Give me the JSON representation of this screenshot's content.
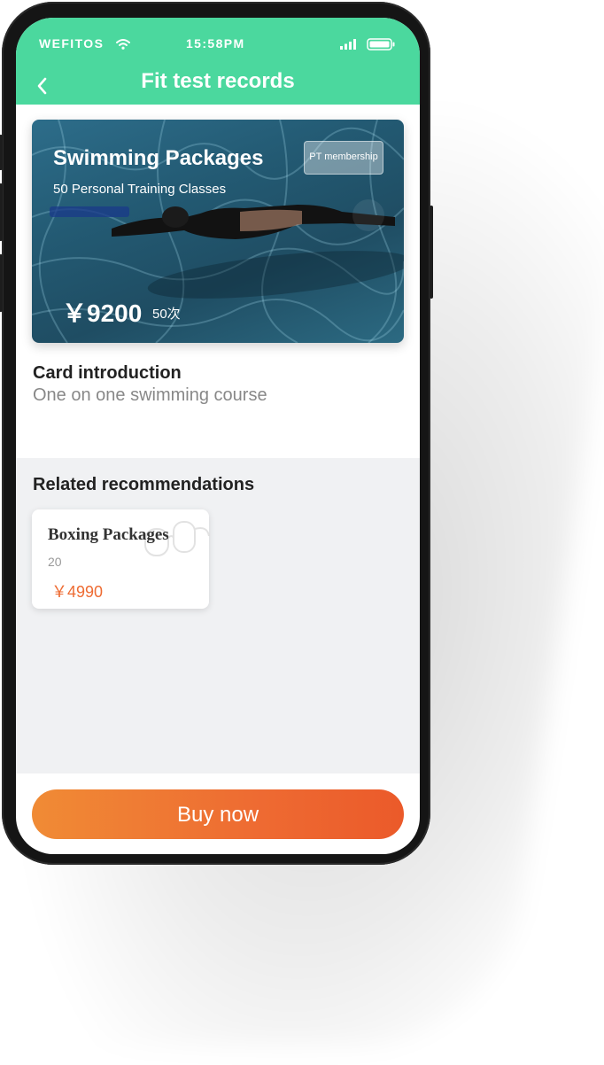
{
  "status_bar": {
    "carrier": "WEFITOS",
    "time": "15:58PM"
  },
  "header": {
    "title": "Fit test records"
  },
  "package_card": {
    "title": "Swimming Packages",
    "subtitle": "50 Personal Training Classes",
    "badge": "PT membership",
    "price": "￥9200",
    "count": "50次"
  },
  "introduction": {
    "title": "Card introduction",
    "text": "One on one swimming course"
  },
  "related": {
    "title": "Related recommendations",
    "items": [
      {
        "title": "Boxing Packages",
        "count": "20",
        "price": "￥4990"
      }
    ]
  },
  "footer": {
    "buy_label": "Buy now"
  },
  "colors": {
    "header": "#4bd89e",
    "accent": "#ee6b32",
    "button_start": "#f08b35",
    "button_end": "#eb5a2a"
  }
}
